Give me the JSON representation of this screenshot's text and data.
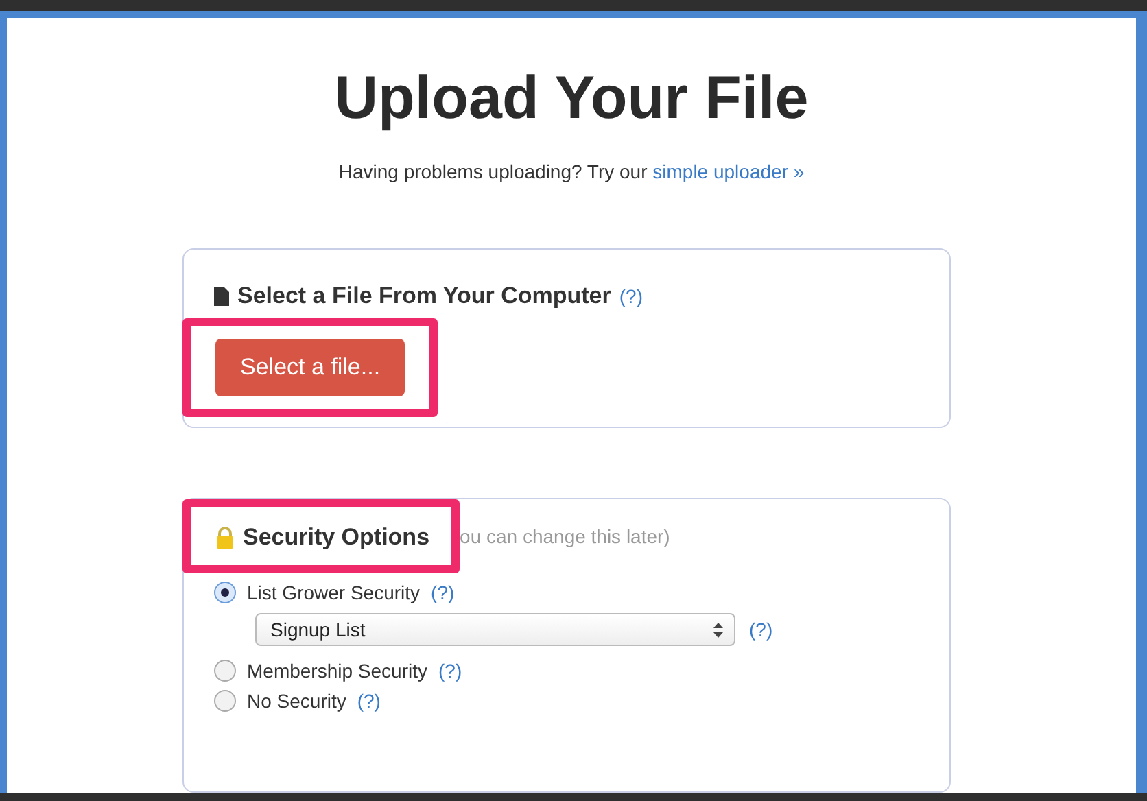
{
  "title": "Upload Your File",
  "subtitle": {
    "text": "Having problems uploading? Try our",
    "link": "simple uploader »"
  },
  "file_section": {
    "heading": "Select a File From Your Computer",
    "help": "(?)",
    "button": "Select a file...",
    "highlighted": true
  },
  "security_section": {
    "heading": "Security Options",
    "note": "ou can change this later)",
    "highlighted": true,
    "options": [
      {
        "label": "List Grower Security",
        "help": "(?)",
        "selected": true,
        "select": {
          "value": "Signup List",
          "help": "(?)"
        }
      },
      {
        "label": "Membership Security",
        "help": "(?)",
        "selected": false
      },
      {
        "label": "No Security",
        "help": "(?)",
        "selected": false
      }
    ]
  }
}
